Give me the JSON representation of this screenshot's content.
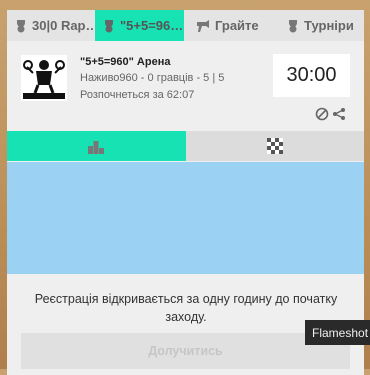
{
  "tabs": [
    {
      "label": "30|0 Rap…",
      "icon": "trophy-icon"
    },
    {
      "label": "\"5+5=96…",
      "icon": "trophy-icon"
    },
    {
      "label": "Грайте",
      "icon": "horn-icon"
    },
    {
      "label": "Турніри",
      "icon": "trophy-icon"
    }
  ],
  "tournament": {
    "name": "\"5+5=960\" Арена",
    "details": "Наживо960 - 0 гравців - 5 | 5",
    "starts": "Розпочнеться за 62:07",
    "clock": "30:00"
  },
  "subtabs": [
    {
      "icon": "podium-icon"
    },
    {
      "icon": "chessboard-icon"
    }
  ],
  "notice": "Реєстрація відкривається за одну годину до початку заходу.",
  "join_label": "Долучитись",
  "tooltip": "Flameshot",
  "colors": {
    "accent": "#17e2b3",
    "info_panel": "#9bd1f3"
  }
}
